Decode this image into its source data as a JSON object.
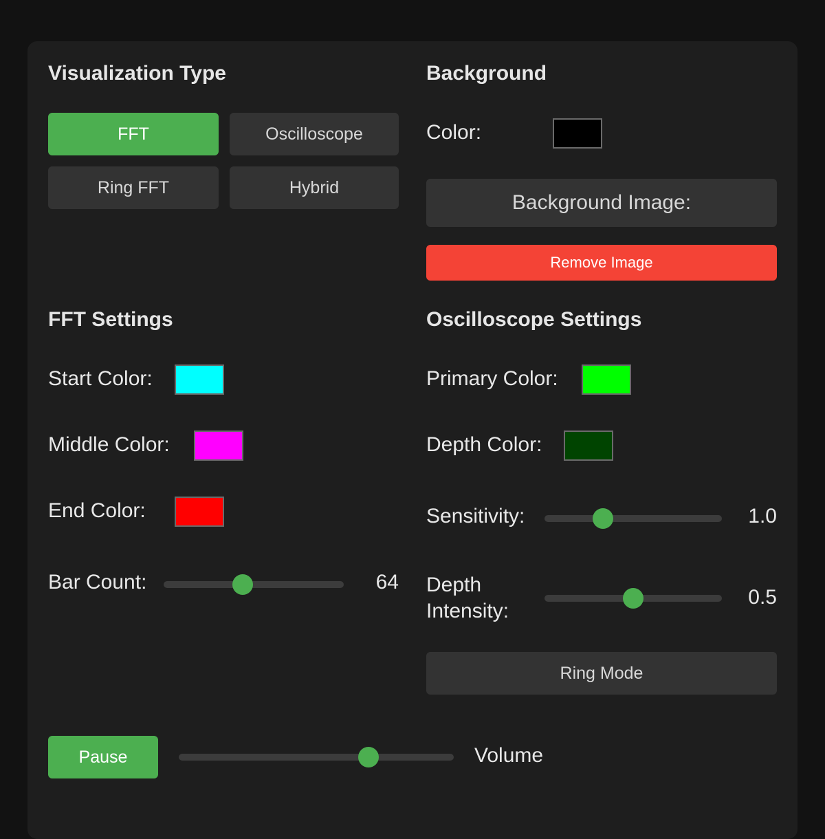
{
  "visualization": {
    "title": "Visualization Type",
    "buttons": [
      "FFT",
      "Oscilloscope",
      "Ring FFT",
      "Hybrid"
    ],
    "active": "FFT"
  },
  "background": {
    "title": "Background",
    "color_label": "Color:",
    "color": "#000000",
    "image_button": "Background Image:",
    "remove_button": "Remove Image",
    "remove_color": "#f44336"
  },
  "fft": {
    "title": "FFT Settings",
    "start_label": "Start Color:",
    "start_color": "#00ffff",
    "middle_label": "Middle Color:",
    "middle_color": "#ff00ff",
    "end_label": "End Color:",
    "end_color": "#ff0000",
    "bar_count_label": "Bar Count:",
    "bar_count": "64",
    "bar_count_fraction": 0.44
  },
  "oscilloscope": {
    "title": "Oscilloscope Settings",
    "primary_label": "Primary Color:",
    "primary_color": "#00ff00",
    "depth_label": "Depth Color:",
    "depth_color": "#004400",
    "sensitivity_label": "Sensitivity:",
    "sensitivity": "1.0",
    "sensitivity_fraction": 0.33,
    "depth_intensity_label": "Depth Intensity:",
    "depth_intensity": "0.5",
    "depth_intensity_fraction": 0.5,
    "ring_mode_button": "Ring Mode"
  },
  "playback": {
    "pause_button": "Pause",
    "volume_label": "Volume",
    "volume_fraction": 0.69
  },
  "accent": "#4caf50"
}
